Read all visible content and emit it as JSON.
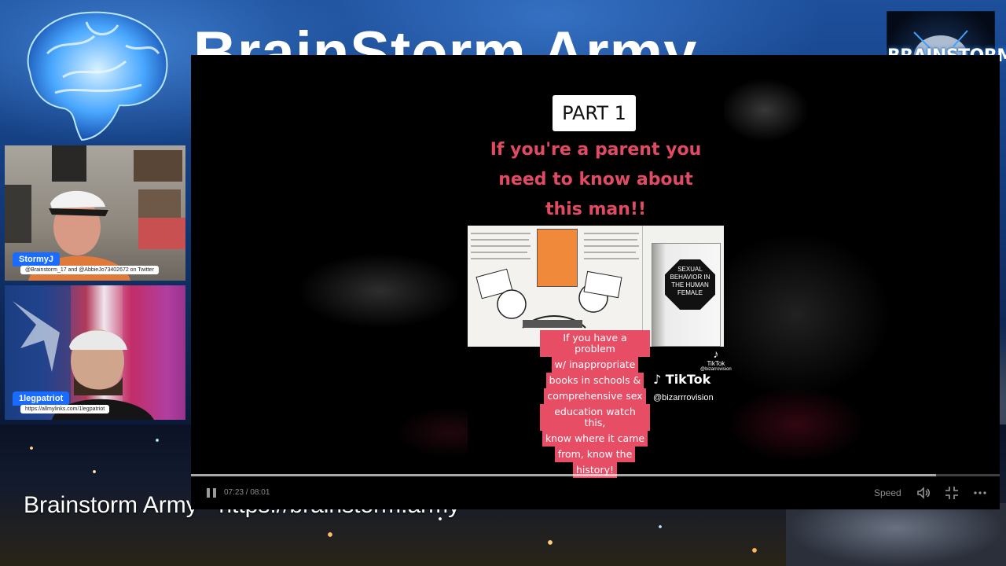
{
  "brand": {
    "title": "BrainStorm Army",
    "corner_logo_text": "BRAINSTORM",
    "bottom_text": "Brainstorm Army - https://brainstorm.army"
  },
  "cameras": [
    {
      "name": "StormyJ",
      "subtitle": "@Brainstorm_17 and @AbbieJo73402672 on Twitter"
    },
    {
      "name": "1legpatriot",
      "subtitle": "https://allmylinks.com/1legpatriot"
    }
  ],
  "video": {
    "part_label": "PART 1",
    "headline": "If you're a parent you need to know about this man!!",
    "caption_lines": [
      "If you have a problem",
      "w/ inappropriate",
      "books in schools &",
      "comprehensive sex",
      "education watch this,",
      "know where it came",
      "from, know the",
      "history!"
    ],
    "book_title": "SEXUAL BEHAVIOR IN THE HUMAN FEMALE",
    "tiktok_small": "TikTok",
    "tiktok_small_handle": "@bizarrovision",
    "tiktok_brand": "TikTok",
    "tiktok_handle": "@bizarrrovision"
  },
  "player": {
    "current_time": "07:23",
    "duration": "08:01",
    "time_display": "07:23 / 08:01",
    "speed_label": "Speed",
    "progress": 0.921,
    "icons": [
      "pause-icon",
      "volume-icon",
      "exit-fullscreen-icon",
      "more-options-icon"
    ]
  }
}
